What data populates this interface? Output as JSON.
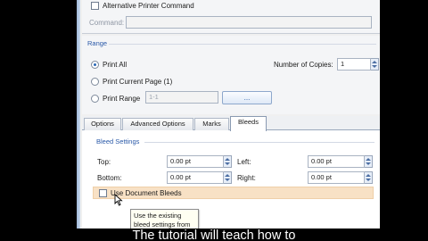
{
  "top": {
    "alt_printer_label": "Alternative Printer Command",
    "command_label": "Command:",
    "command_value": ""
  },
  "range": {
    "title": "Range",
    "print_all": "Print All",
    "print_current_page": "Print Current Page (1)",
    "print_range": "Print Range",
    "range_value": "1-1",
    "range_button": "...",
    "copies_label": "Number of Copies:",
    "copies_value": "1"
  },
  "tabs": [
    "Options",
    "Advanced Options",
    "Marks",
    "Bleeds"
  ],
  "bleed": {
    "title": "Bleed Settings",
    "top_label": "Top:",
    "top_value": "0.00 pt",
    "left_label": "Left:",
    "left_value": "0.00 pt",
    "bottom_label": "Bottom:",
    "bottom_value": "0.00 pt",
    "right_label": "Right:",
    "right_value": "0.00 pt",
    "use_document_bleeds": "Use Document Bleeds"
  },
  "tooltip": {
    "line1": "Use the existing",
    "line2": "bleed settings from"
  },
  "subtitle": "The tutorial will teach how to"
}
